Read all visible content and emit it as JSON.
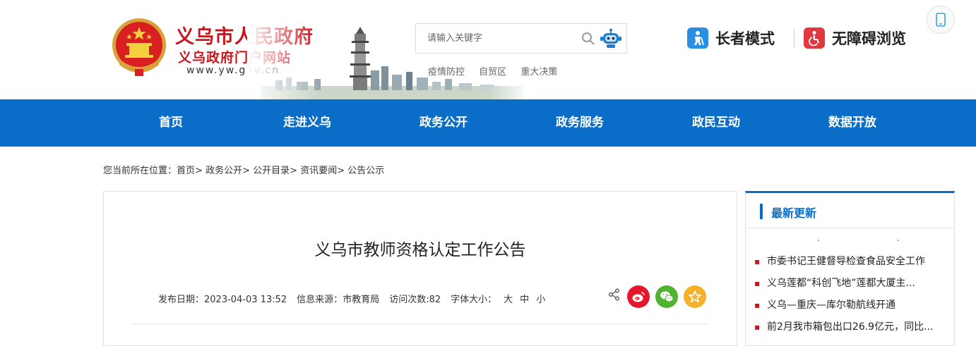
{
  "header": {
    "title": "义乌市人民政府",
    "subtitle": "义乌政府门户网站",
    "url": "www.yw.gov.cn"
  },
  "search": {
    "placeholder": "请输入关键字",
    "hot_links": [
      "疫情防控",
      "自贸区",
      "重大决策"
    ]
  },
  "modes": {
    "elder": "长者模式",
    "accessible": "无障碍浏览"
  },
  "nav": {
    "items": [
      "首页",
      "走进义乌",
      "政务公开",
      "政务服务",
      "政民互动",
      "数据开放"
    ]
  },
  "breadcrumb": {
    "prefix": "您当前所在位置：",
    "items": [
      "首页",
      "政务公开",
      "公开目录",
      "资讯要闻",
      "公告公示"
    ],
    "separator": ">"
  },
  "article": {
    "title": "义乌市教师资格认定工作公告",
    "publish_label": "发布日期：",
    "publish_date": "2023-04-03 13:52",
    "source_label": "信息来源：",
    "source": "市教育局",
    "views_label": "访问次数:",
    "views": "82",
    "font_label": "字体大小：",
    "font_sizes": [
      "大",
      "中",
      "小"
    ]
  },
  "sidebar": {
    "title": "最新更新",
    "items": [
      "市委书记王健督导检查食品安全工作",
      "义乌莲都“科创飞地”莲都大厦主...",
      "义乌—重庆—库尔勒航线开通",
      "前2月我市箱包出口26.9亿元，同比..."
    ]
  },
  "colors": {
    "brand_red": "#c8161d",
    "nav_blue": "#0a6dc8",
    "weibo": "#e6162d",
    "wechat": "#51b332",
    "favorite": "#f6b02a"
  },
  "icons": [
    "national-emblem-icon",
    "search-icon",
    "robot-icon",
    "elder-mode-icon",
    "accessibility-icon",
    "mobile-icon",
    "share-icon",
    "weibo-icon",
    "wechat-icon",
    "favorite-icon"
  ]
}
